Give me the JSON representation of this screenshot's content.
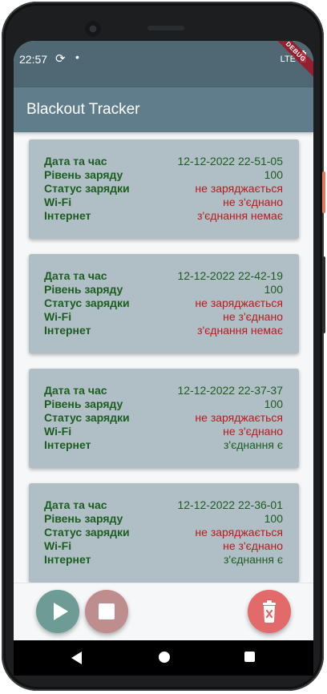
{
  "status_bar": {
    "time": "22:57",
    "sync_icon": "sync-icon",
    "dot": "•",
    "network": "LTE",
    "debug_banner": "DEBUG"
  },
  "app_bar": {
    "title": "Blackout Tracker"
  },
  "labels": {
    "datetime": "Дата та час",
    "charge_level": "Рівень заряду",
    "charging_status": "Статус зарядки",
    "wifi": "Wi-Fi",
    "internet": "Інтернет"
  },
  "records": [
    {
      "datetime": "12-12-2022 22-51-05",
      "charge_level": "100",
      "charging_status": "не заряджається",
      "wifi": "не з'єднано",
      "internet": "з'єднання немає"
    },
    {
      "datetime": "12-12-2022 22-42-19",
      "charge_level": "100",
      "charging_status": "не заряджається",
      "wifi": "не з'єднано",
      "internet": "з'єднання немає"
    },
    {
      "datetime": "12-12-2022 22-37-37",
      "charge_level": "100",
      "charging_status": "не заряджається",
      "wifi": "не з'єднано",
      "internet": "з'єднання є"
    },
    {
      "datetime": "12-12-2022 22-36-01",
      "charge_level": "100",
      "charging_status": "не заряджається",
      "wifi": "не з'єднано",
      "internet": "з'єднання є"
    }
  ],
  "actions": {
    "start_icon": "play-icon",
    "stop_icon": "stop-icon",
    "delete_icon": "delete-icon"
  },
  "colors": {
    "app_bar": "#607d8b",
    "status_bar": "#4f6873",
    "card": "#b0bec5",
    "label_green": "#1b5e20",
    "negative_red": "#b71c1c",
    "start_fab": "#6d9c96",
    "stop_fab": "#bf8d8d",
    "delete_fab": "#e36a6a"
  }
}
